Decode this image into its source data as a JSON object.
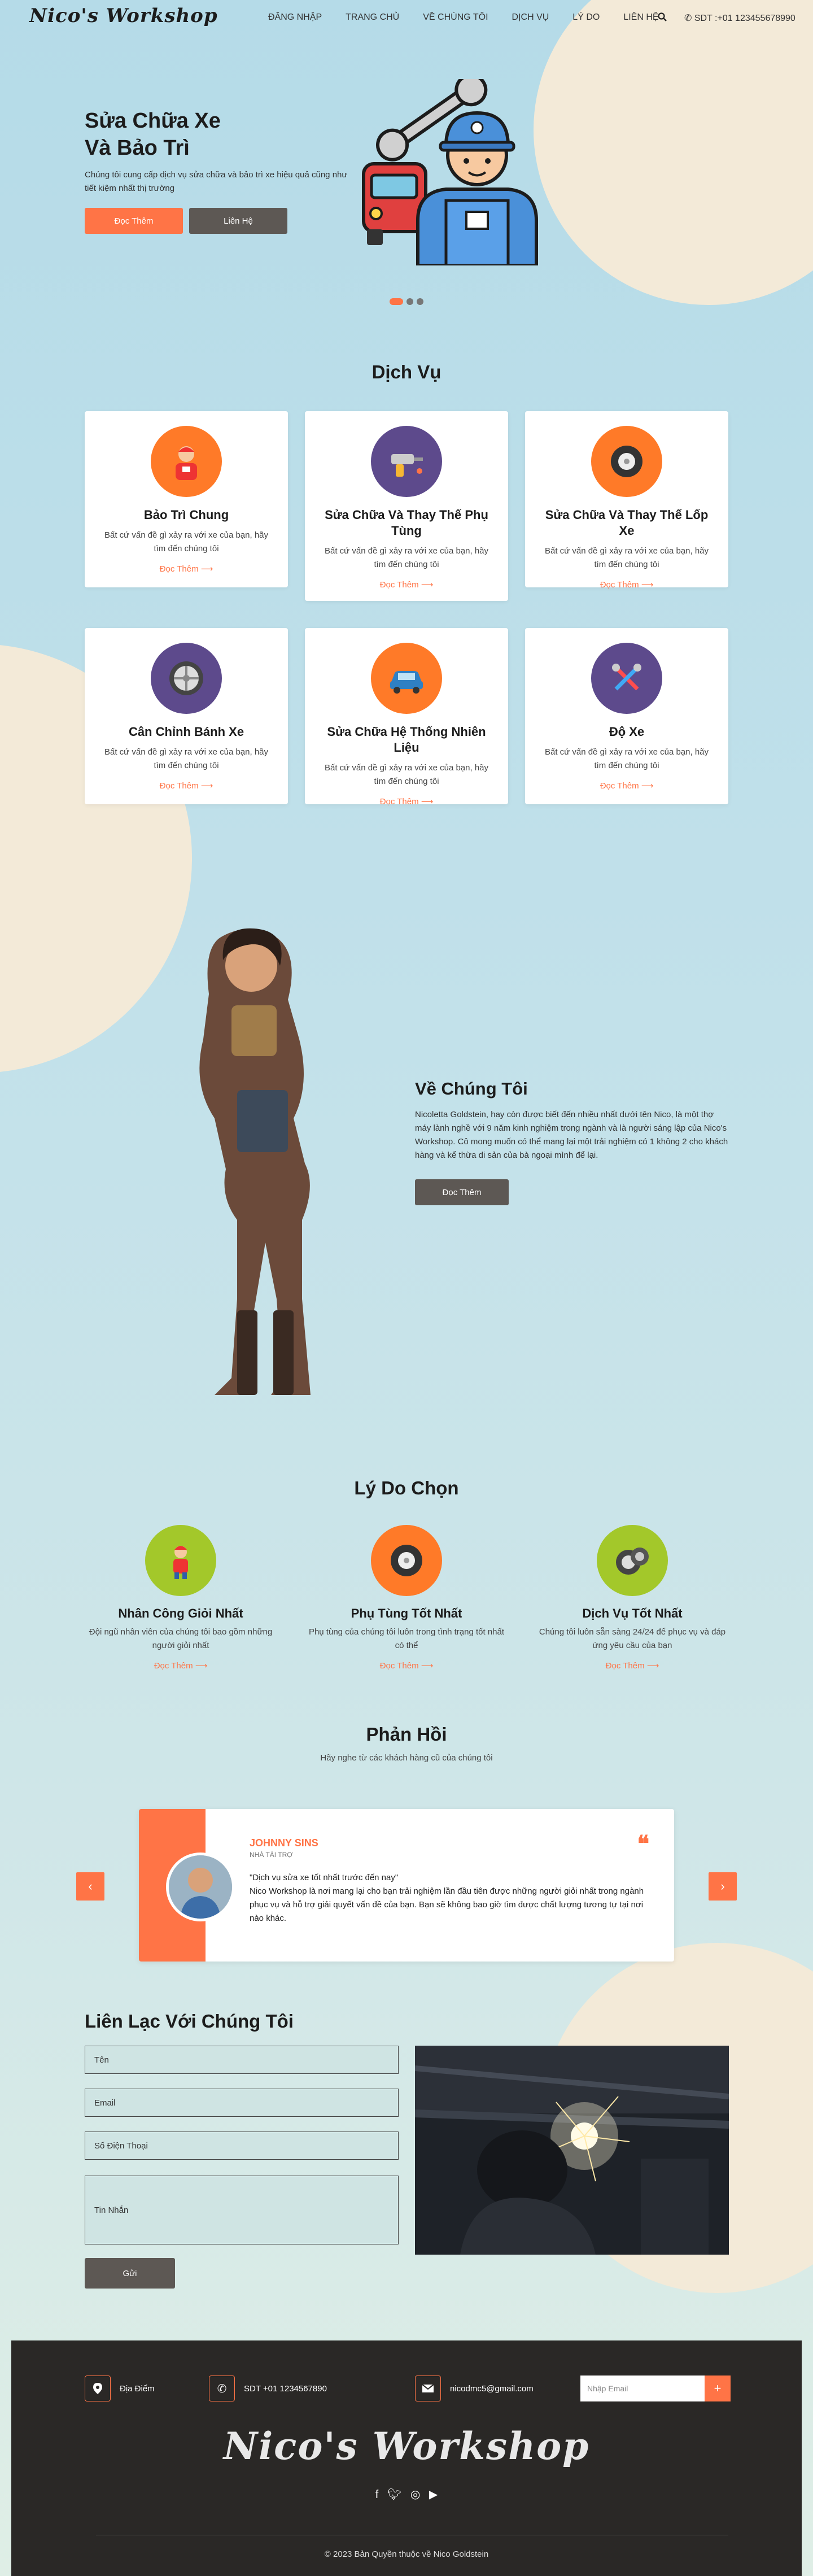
{
  "header": {
    "logo": "Nico's Workshop",
    "nav": [
      "ĐĂNG NHẬP",
      "TRANG CHỦ",
      "VỀ CHÚNG TÔI",
      "DỊCH VỤ",
      "LÝ DO",
      "LIÊN HỆ"
    ],
    "phone": "SDT :+01 123455678990"
  },
  "hero": {
    "title_line1": "Sửa Chữa Xe",
    "title_line2": "Và Bảo Trì",
    "text": "Chúng tôi cung cấp dịch vụ sửa chữa và bảo trì xe hiệu quả cũng như tiết kiệm nhất thị trường",
    "btn_primary": "Đọc Thêm",
    "btn_secondary": "Liên Hệ"
  },
  "services": {
    "title": "Dịch Vụ",
    "items": [
      {
        "title": "Bảo Trì Chung",
        "text": "Bất cứ vấn đề gì xảy ra với xe của bạn, hãy tìm đến chúng tôi",
        "more": "Đọc Thêm ⟶",
        "icon": "mechanic-icon",
        "color": "#ff7a28"
      },
      {
        "title": "Sửa Chữa Và Thay Thế Phụ Tùng",
        "text": "Bất cứ vấn đề gì xảy ra với xe của bạn, hãy tìm đến chúng tôi",
        "more": "Đọc Thêm ⟶",
        "icon": "drill-icon",
        "color": "#5d4a8c"
      },
      {
        "title": "Sửa Chữa Và Thay Thế Lốp Xe",
        "text": "Bất cứ vấn đề gì xảy ra với xe của bạn, hãy tìm đến chúng tôi",
        "more": "Đọc Thêm ⟶",
        "icon": "tire-icon",
        "color": "#ff7a28"
      },
      {
        "title": "Cân Chỉnh Bánh Xe",
        "text": "Bất cứ vấn đề gì xảy ra với xe của bạn, hãy tìm đến chúng tôi",
        "more": "Đọc Thêm ⟶",
        "icon": "wheel-rim-icon",
        "color": "#5d4a8c"
      },
      {
        "title": "Sửa Chữa Hệ Thống Nhiên Liệu",
        "text": "Bất cứ vấn đề gì xảy ra với xe của bạn, hãy tìm đến chúng tôi",
        "more": "Đọc Thêm ⟶",
        "icon": "car-icon",
        "color": "#ff7a28"
      },
      {
        "title": "Độ Xe",
        "text": "Bất cứ vấn đề gì xảy ra với xe của bạn, hãy tìm đến chúng tôi",
        "more": "Đọc Thêm ⟶",
        "icon": "tools-icon",
        "color": "#5d4a8c"
      }
    ]
  },
  "about": {
    "title": "Về Chúng Tôi",
    "text": "Nicoletta Goldstein, hay còn được biết đến nhiều nhất dưới tên Nico, là một thợ máy lành nghề với 9 năm kinh nghiệm trong ngành và là người sáng lập của Nico's Workshop. Cô mong muốn có thể mang lại một trải nghiệm có 1 không 2 cho khách hàng và kể thừa di sản của bà ngoại mình để lại.",
    "btn": "Đọc Thêm"
  },
  "reasons": {
    "title": "Lý Do Chọn",
    "items": [
      {
        "title": "Nhân Công Giỏi Nhất",
        "text": "Đội ngũ nhân viên của chúng tôi bao gồm những người giỏi nhất",
        "more": "Đọc Thêm ⟶",
        "icon": "worker-icon",
        "color": "#a3c82a"
      },
      {
        "title": "Phụ Tùng Tốt Nhất",
        "text": "Phụ tùng của chúng tôi luôn trong tình trạng tốt nhất có thể",
        "more": "Đọc Thêm ⟶",
        "icon": "tire-icon",
        "color": "#ff7a28"
      },
      {
        "title": "Dịch Vụ Tốt Nhất",
        "text": "Chúng tôi luôn sẵn sàng 24/24 để phục vụ và đáp ứng yêu cầu của bạn",
        "more": "Đọc Thêm ⟶",
        "icon": "wheels-icon",
        "color": "#a3c82a"
      }
    ]
  },
  "feedback": {
    "title": "Phản Hồi",
    "subtitle": "Hãy nghe từ các khách hàng cũ của chúng tôi",
    "name": "JOHNNY SINS",
    "role": "NHÀ TÀI TRỢ",
    "quote": "\"Dịch vụ sửa xe tốt nhất trước đến nay\"",
    "text": "Nico Workshop là nơi mang lại cho bạn trải nghiệm lần đầu tiên được những người giỏi nhất trong ngành phục vụ và hỗ trợ giải quyết vấn đề của bạn. Bạn sẽ không bao giờ tìm được chất lượng tương tự tại nơi nào khác."
  },
  "contact": {
    "title": "Liên Lạc Với Chúng Tôi",
    "fields": [
      "Tên",
      "Email",
      "Số Điện Thoại",
      "Tin Nhắn"
    ],
    "submit": "Gửi"
  },
  "footer": {
    "location": "Địa Điểm",
    "phone": "SDT +01 1234567890",
    "email": "nicodmc5@gmail.com",
    "email_placeholder": "Nhập Email",
    "logo": "Nico's Workshop",
    "copyright": "© 2023 Bản Quyền thuộc về Nico Goldstein"
  },
  "colors": {
    "accent": "#ff7446",
    "dark_button": "#5d5854",
    "footer_bg": "#2a2826"
  }
}
